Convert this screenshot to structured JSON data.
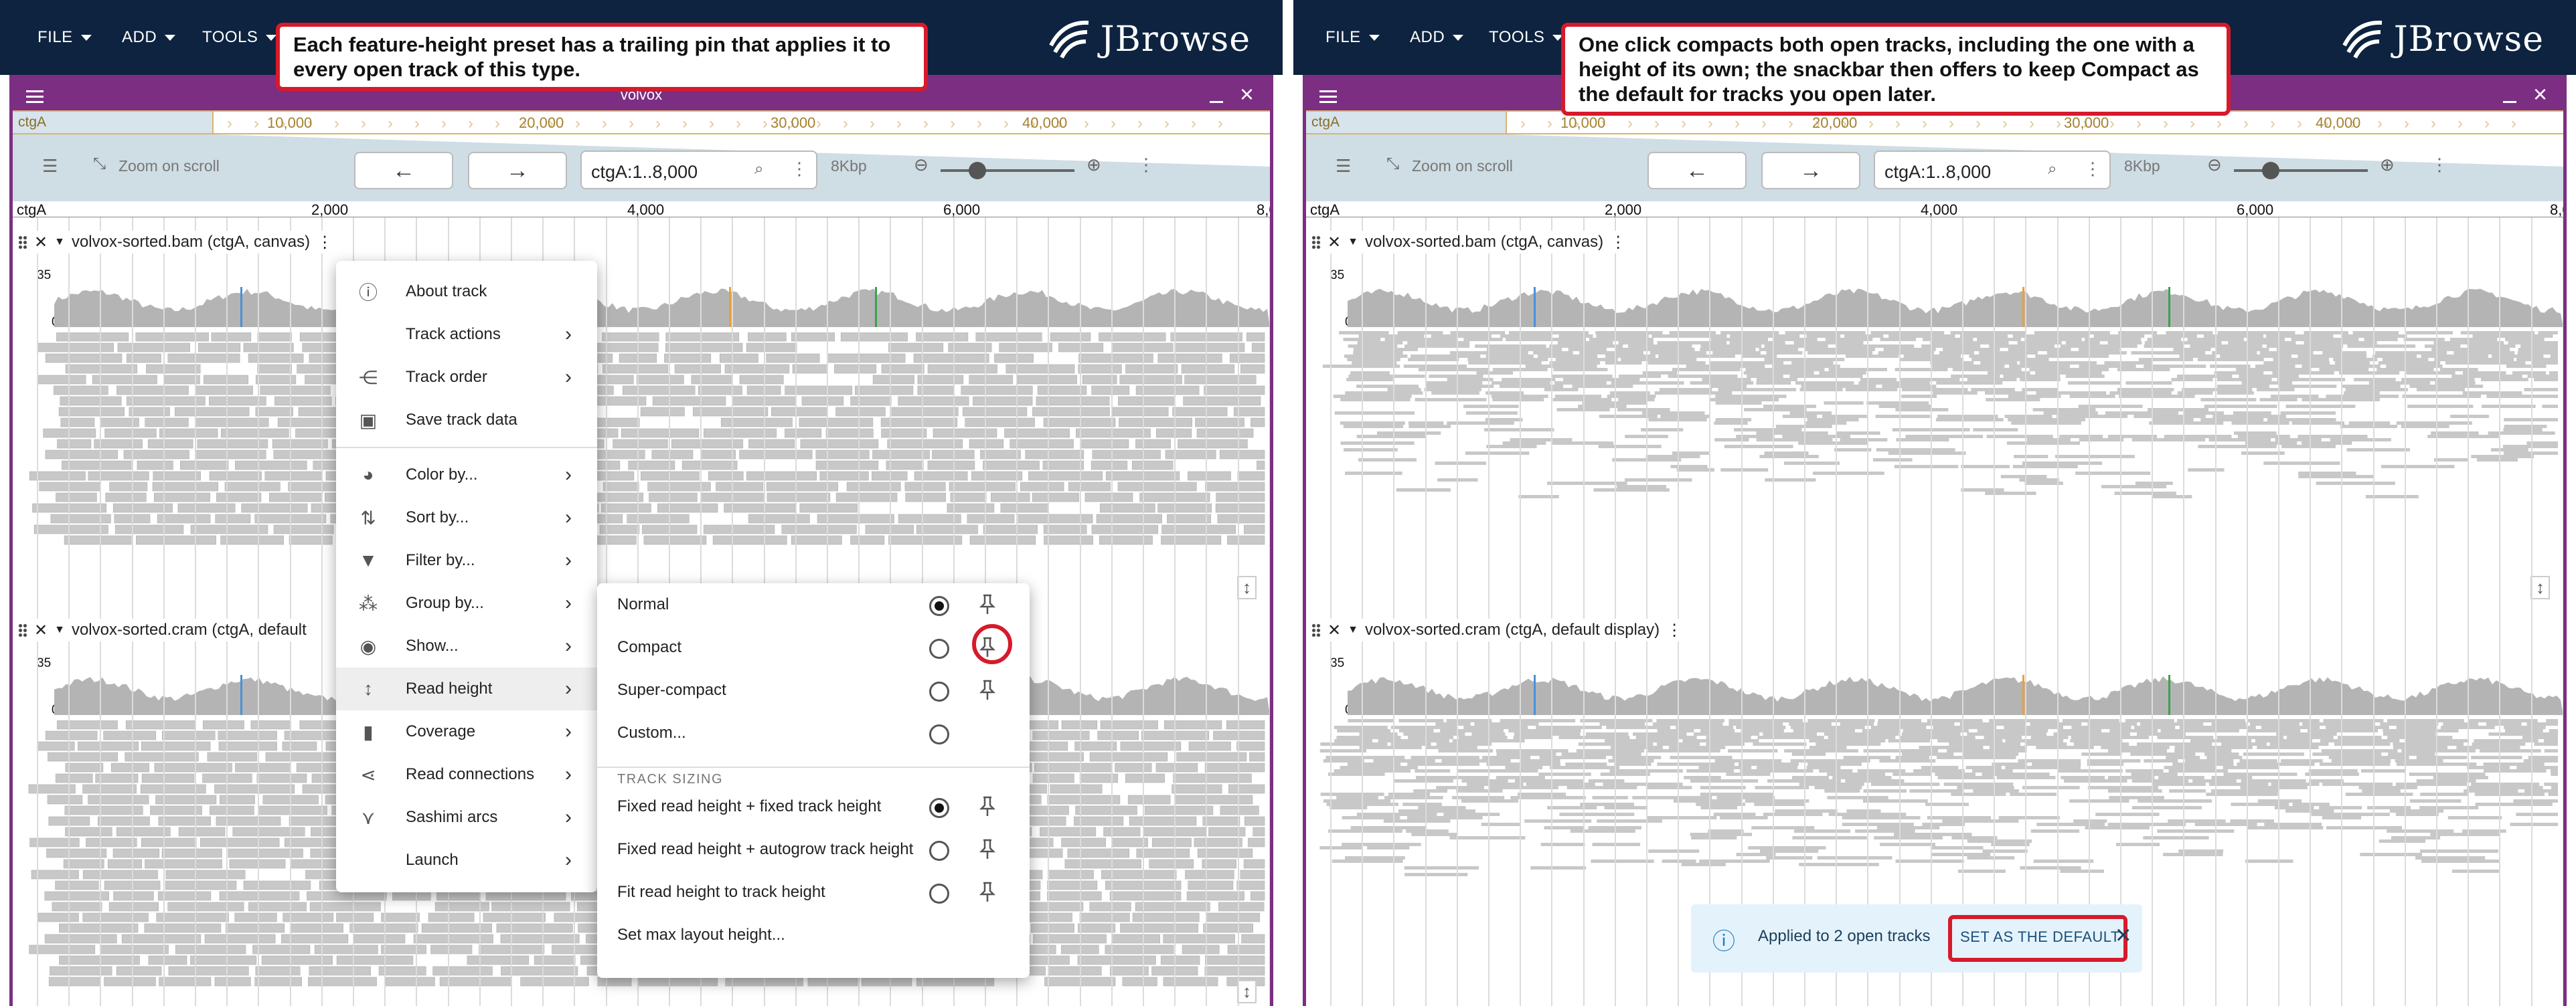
{
  "menubar": {
    "file": "FILE",
    "add": "ADD",
    "tools": "TOOLS"
  },
  "brand": {
    "name": "JBrowse"
  },
  "view": {
    "name": "volvox"
  },
  "callouts": {
    "left": "Each feature-height preset has a trailing pin that applies it to every open track of this type.",
    "right": "One click compacts both open tracks, including the one with a height of its own; the snackbar then offers to keep Compact as the default for tracks you open later."
  },
  "overview": {
    "refname": "ctgA",
    "labels": [
      "10,000",
      "20,000",
      "30,000",
      "40,000"
    ]
  },
  "nav": {
    "zoom_on_scroll": "Zoom on scroll",
    "location": "ctgA:1..8,000",
    "span": "8Kbp"
  },
  "ruler": {
    "refname": "ctgA",
    "ticks": [
      "2,000",
      "4,000",
      "6,000",
      "8,0"
    ]
  },
  "tracks": [
    {
      "name": "volvox-sorted.bam (ctgA, canvas)",
      "axis_max": "35",
      "axis_min": "0"
    },
    {
      "name_left": "volvox-sorted.cram (ctgA, default",
      "name_right": "volvox-sorted.cram (ctgA, default display)",
      "axis_max": "35",
      "axis_min": "0"
    }
  ],
  "track_menu": {
    "items": [
      {
        "label": "About track",
        "icon": "info-icon"
      },
      {
        "label": "Track actions",
        "icon": ""
      },
      {
        "label": "Track order",
        "icon": "track-order-icon"
      },
      {
        "label": "Save track data",
        "icon": "save-icon"
      },
      {
        "label": "Color by...",
        "icon": "palette-icon"
      },
      {
        "label": "Sort by...",
        "icon": "sort-icon"
      },
      {
        "label": "Filter by...",
        "icon": "filter-icon"
      },
      {
        "label": "Group by...",
        "icon": "group-icon"
      },
      {
        "label": "Show...",
        "icon": "eye-icon"
      },
      {
        "label": "Read height",
        "icon": "height-icon"
      },
      {
        "label": "Coverage",
        "icon": "bar-chart-icon"
      },
      {
        "label": "Read connections",
        "icon": "share-icon"
      },
      {
        "label": "Sashimi arcs",
        "icon": "arcs-icon"
      },
      {
        "label": "Launch",
        "icon": ""
      }
    ]
  },
  "read_height_menu": {
    "presets": [
      {
        "label": "Normal",
        "selected": true,
        "pin": true
      },
      {
        "label": "Compact",
        "selected": false,
        "pin": true
      },
      {
        "label": "Super-compact",
        "selected": false,
        "pin": true
      },
      {
        "label": "Custom...",
        "selected": false,
        "pin": false
      }
    ],
    "section_title": "TRACK SIZING",
    "sizing": [
      {
        "label": "Fixed read height + fixed track height",
        "selected": true,
        "pin": true
      },
      {
        "label": "Fixed read height + autogrow track height",
        "selected": false,
        "pin": true
      },
      {
        "label": "Fit read height to track height",
        "selected": false,
        "pin": true
      }
    ],
    "max_layout": "Set max layout height..."
  },
  "snackbar": {
    "message": "Applied to 2 open tracks",
    "action": "SET AS THE DEFAULT"
  },
  "colors": {
    "appbar": "#0d233f",
    "view_border": "#7c2f82",
    "highlight": "#d71a2b",
    "reads": "#c8c8c8",
    "coverage": "#b4b4b4"
  }
}
